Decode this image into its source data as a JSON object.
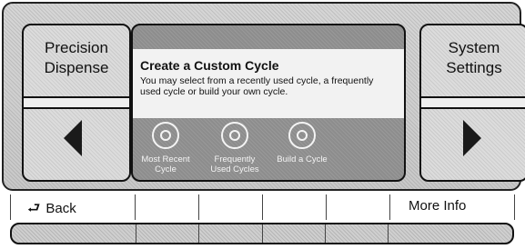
{
  "left_panel": {
    "line1": "Precision",
    "line2": "Dispense",
    "arrow": "left-arrow-icon"
  },
  "right_panel": {
    "line1": "System",
    "line2": "Settings",
    "arrow": "right-arrow-icon"
  },
  "screen": {
    "heading": "Create a Custom Cycle",
    "description": "You may select from a recently used cycle, a frequently used cycle or build your own cycle.",
    "options": [
      {
        "label": "Most Recent\nCycle",
        "icon": "heart-circle-icon"
      },
      {
        "label": "Frequently\nUsed Cycles",
        "icon": "recycle-circle-icon"
      },
      {
        "label": "Build a Cycle",
        "icon": "build-circle-icon"
      }
    ]
  },
  "bottom": {
    "back_label": "Back",
    "back_icon": "back-arrow-icon",
    "more_info_label": "More Info"
  },
  "colors": {
    "screen_bg": "#8d8d8d",
    "panel_bg": "#dcdcdc",
    "text": "#111111"
  }
}
